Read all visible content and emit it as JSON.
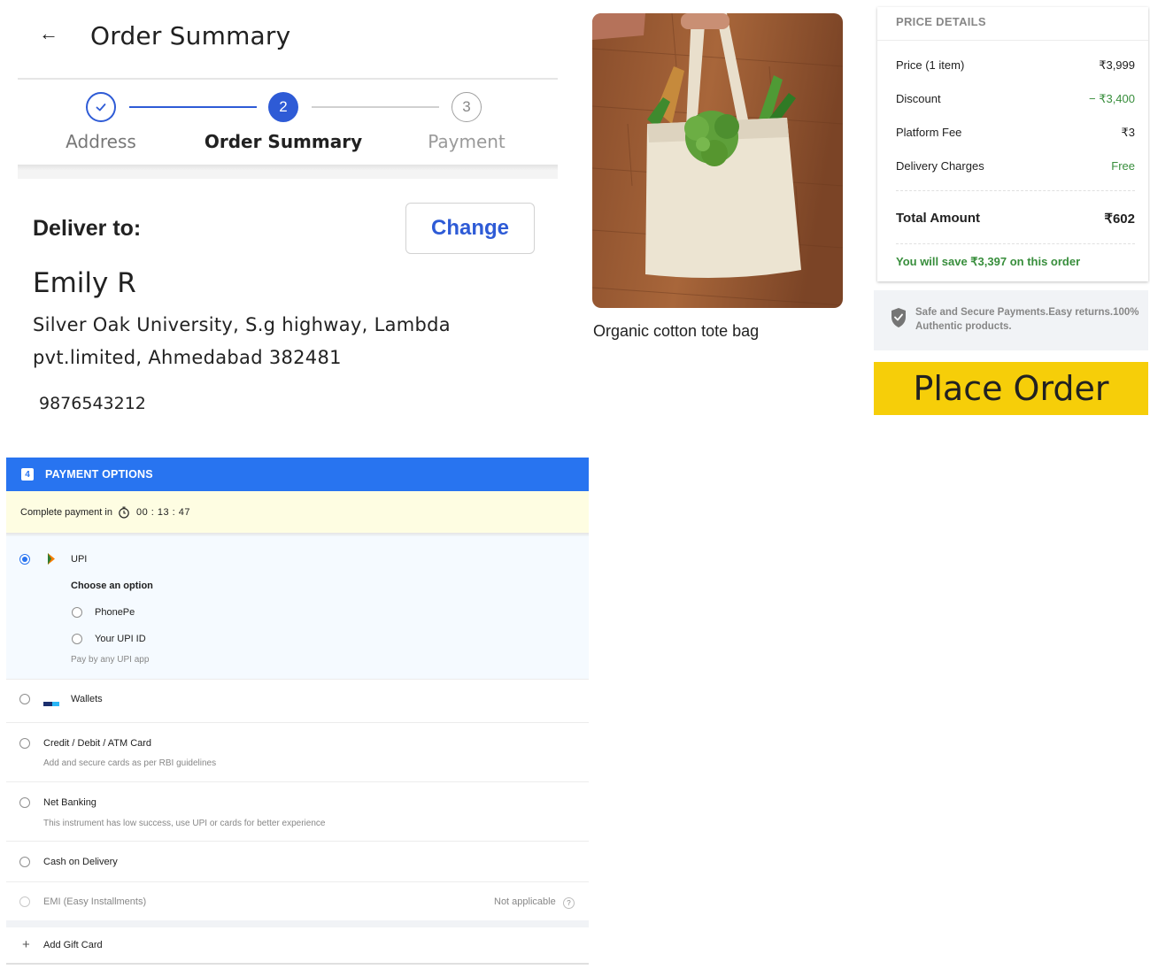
{
  "header": {
    "back_icon": "arrow-left-icon",
    "title": "Order Summary"
  },
  "stepper": {
    "steps": [
      {
        "number": "",
        "label": "Address",
        "state": "done"
      },
      {
        "number": "2",
        "label": "Order Summary",
        "state": "active"
      },
      {
        "number": "3",
        "label": "Payment",
        "state": "pending"
      }
    ]
  },
  "delivery": {
    "heading": "Deliver to:",
    "change_label": "Change",
    "name": "Emily R",
    "address_line1": "Silver Oak University, S.g highway, Lambda",
    "address_line2": "pvt.limited, Ahmedabad 382481",
    "phone": "9876543212"
  },
  "product": {
    "name": "Organic cotton tote bag"
  },
  "price_details": {
    "title": "PRICE DETAILS",
    "rows": [
      {
        "label": "Price (1 item)",
        "value": "₹3,999"
      },
      {
        "label": "Discount",
        "value": "− ₹3,400"
      },
      {
        "label": "Platform Fee",
        "value": "₹3"
      },
      {
        "label": "Delivery Charges",
        "value": "Free"
      }
    ],
    "total_label": "Total Amount",
    "total_value": "₹602",
    "savings": "You will save ₹3,397 on this order"
  },
  "secure": {
    "text": "Safe and Secure Payments.Easy returns.100% Authentic products."
  },
  "place_order_label": "Place Order",
  "payment": {
    "step_number": "4",
    "title": "PAYMENT OPTIONS",
    "timer_label": "Complete payment in",
    "timer_value": "00 : 13 : 47",
    "upi": {
      "label": "UPI",
      "choose": "Choose an option",
      "options": [
        "PhonePe",
        "Your UPI ID"
      ],
      "hint": "Pay by any UPI app"
    },
    "wallets": "Wallets",
    "card": {
      "label": "Credit / Debit / ATM Card",
      "sub": "Add and secure cards as per RBI guidelines"
    },
    "netbanking": {
      "label": "Net Banking",
      "sub": "This instrument has low success, use UPI or cards for better experience"
    },
    "cod": "Cash on Delivery",
    "emi": {
      "label": "EMI (Easy Installments)",
      "status": "Not applicable",
      "help": "?"
    },
    "gift_card": "Add Gift Card"
  },
  "colors": {
    "accent_blue": "#2874f0",
    "stepper_blue": "#2e5bd6",
    "place_order_yellow": "#f6ce09",
    "savings_green": "#388e3c"
  }
}
